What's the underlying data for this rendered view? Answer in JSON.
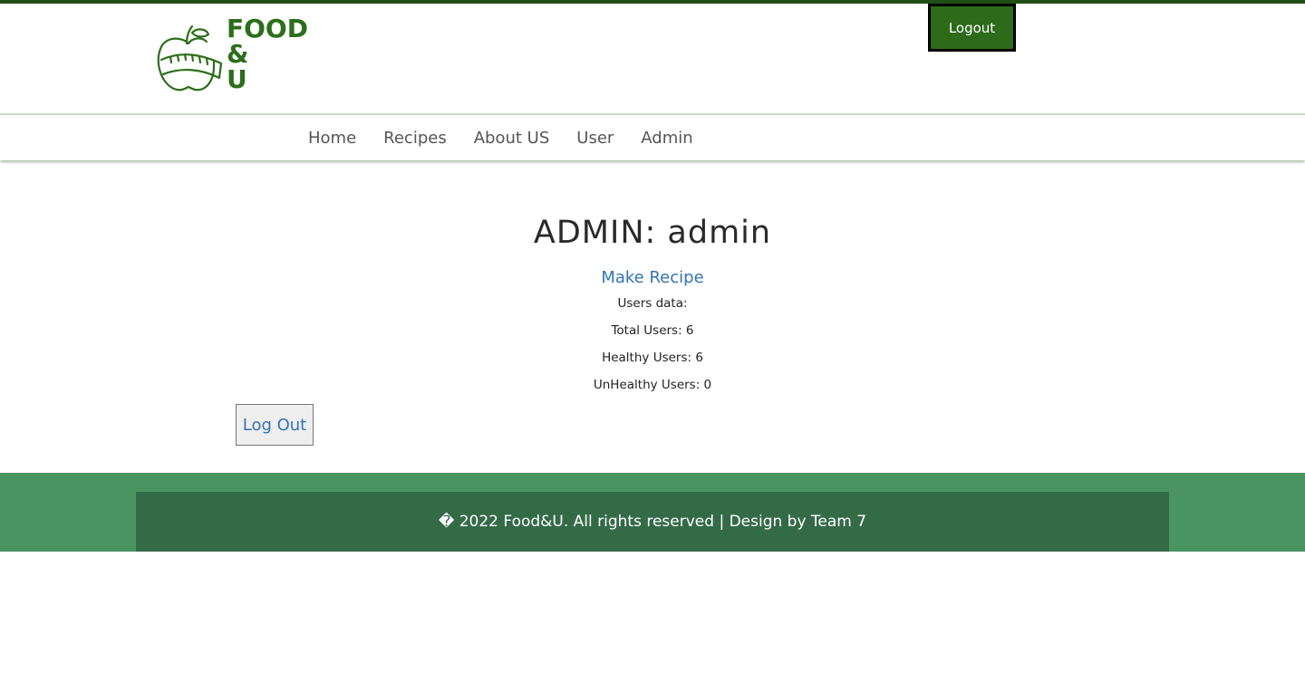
{
  "header": {
    "logo_lines": [
      "FOOD",
      "&",
      "U"
    ],
    "logout_label": "Logout",
    "brand_color": "#2c6e1b"
  },
  "nav": {
    "items": [
      {
        "label": "Home"
      },
      {
        "label": "Recipes"
      },
      {
        "label": "About US"
      },
      {
        "label": "User"
      },
      {
        "label": "Admin"
      }
    ]
  },
  "main": {
    "title": "ADMIN: admin",
    "make_recipe_label": "Make Recipe",
    "users_data_label": "Users data:",
    "total_users": "Total Users: 6",
    "healthy_users": "Healthy Users: 6",
    "unhealthy_users": "UnHealthy Users: 0",
    "logout_label": "Log Out"
  },
  "footer": {
    "text": "� 2022 Food&U. All rights reserved | Design by Team 7"
  }
}
